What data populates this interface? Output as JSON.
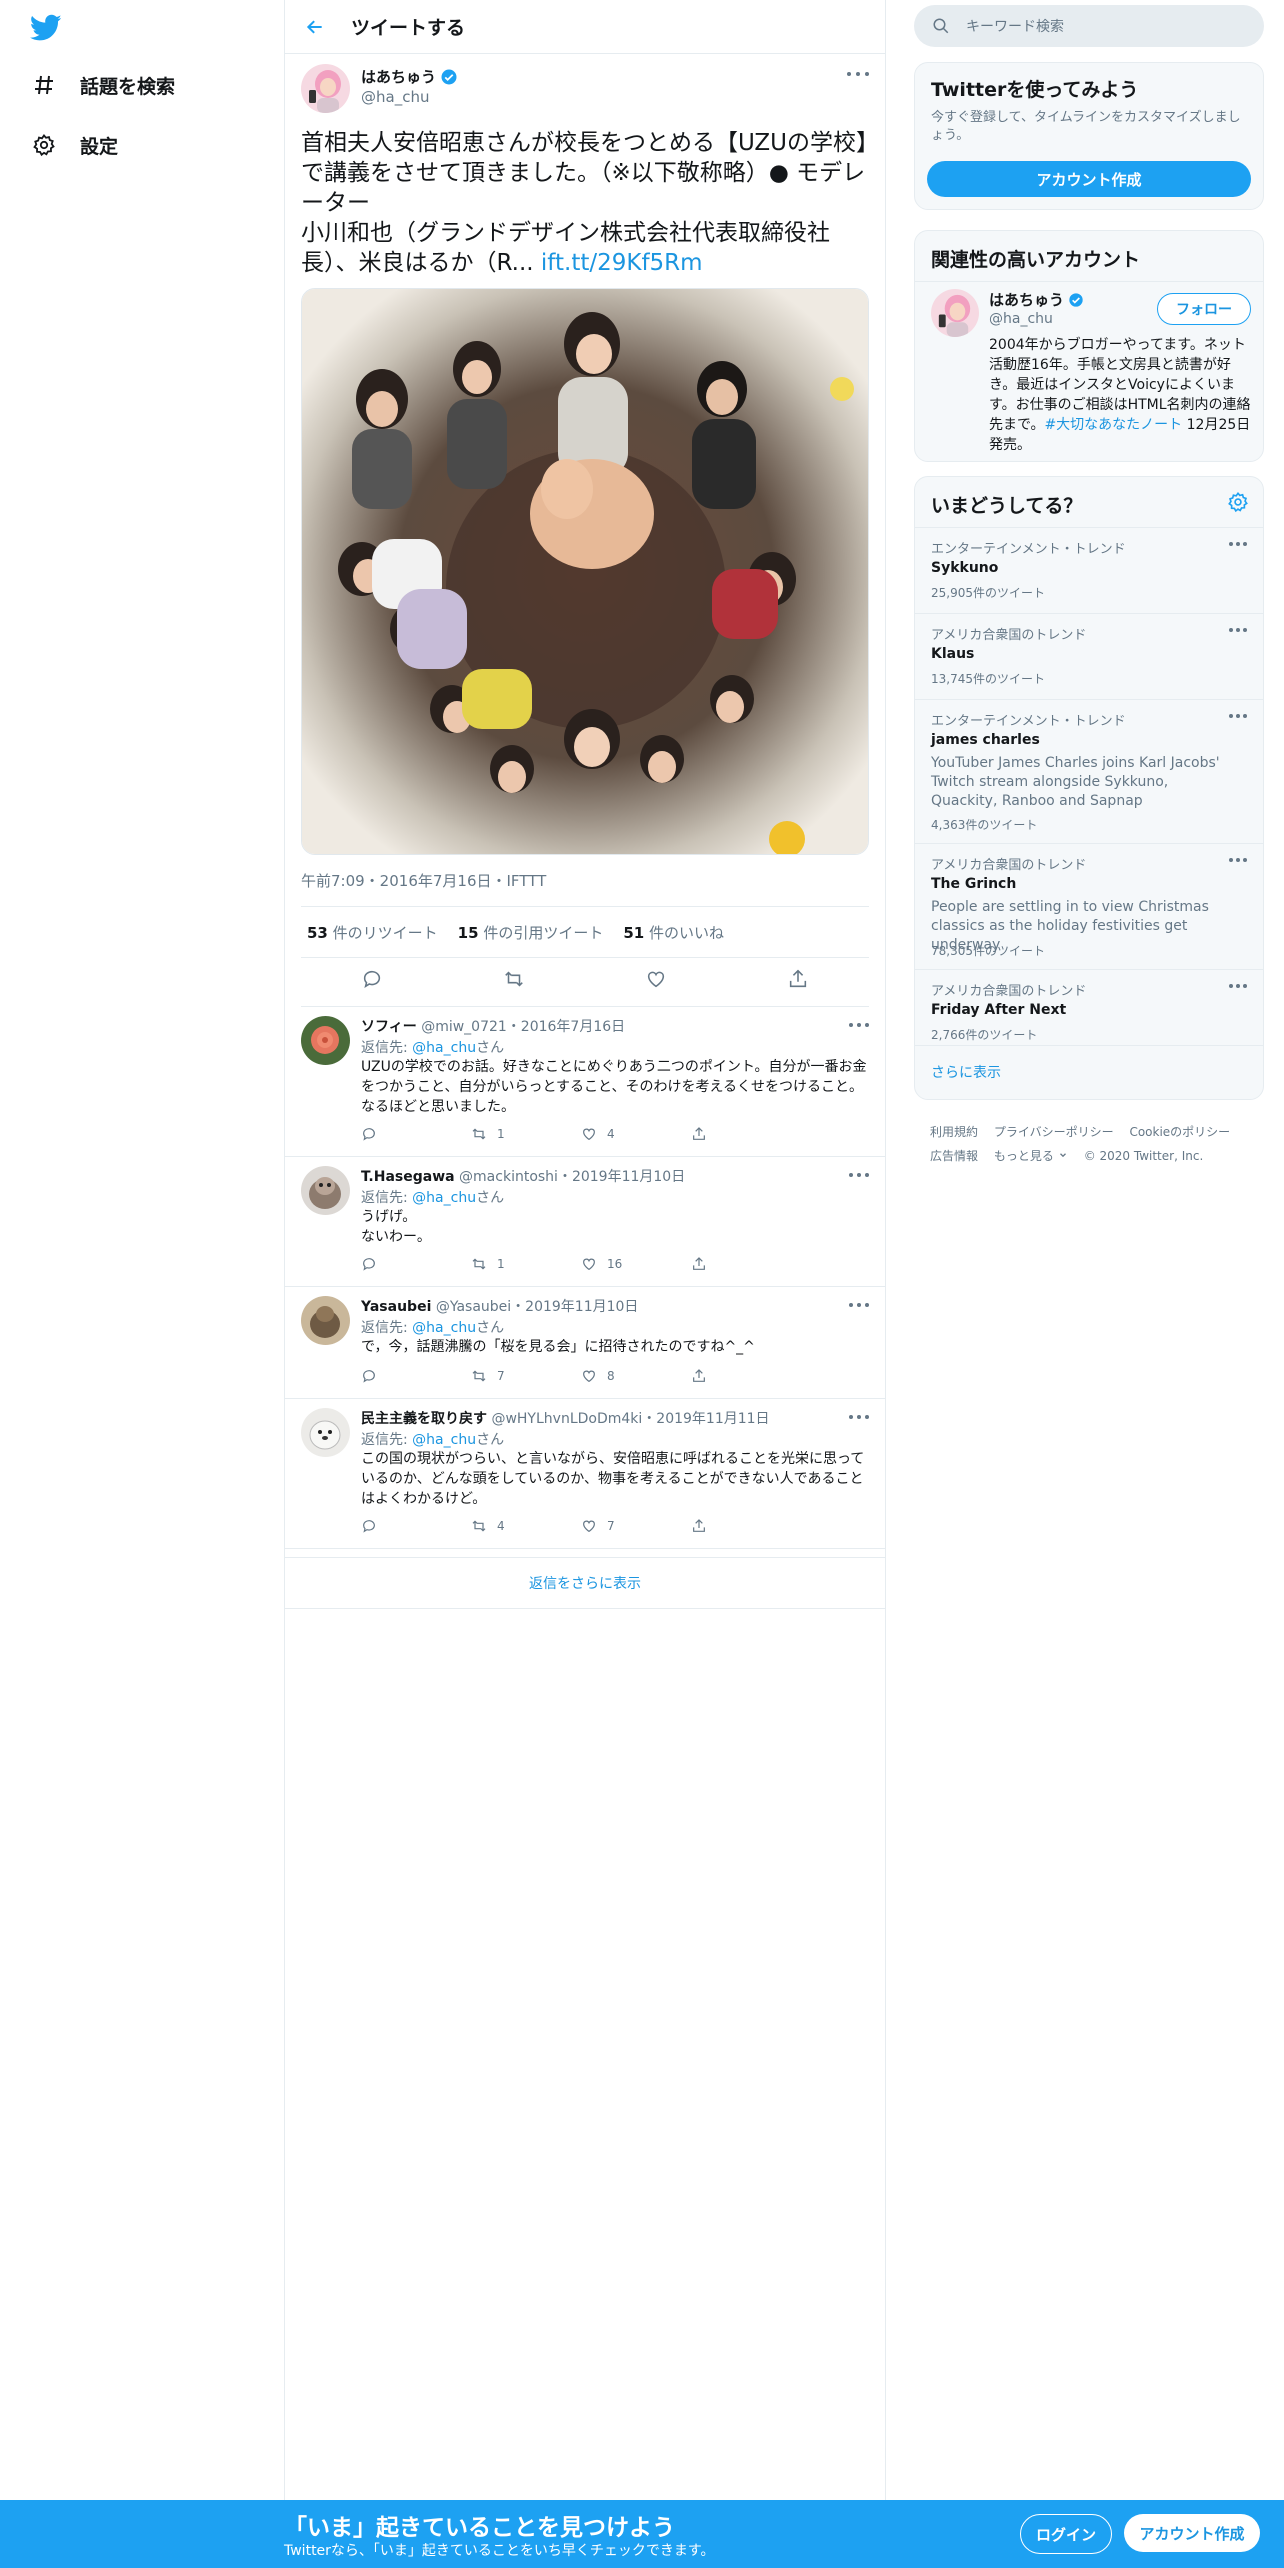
{
  "nav": {
    "explore_label": "話題を検索",
    "settings_label": "設定"
  },
  "header": {
    "title": "ツイートする"
  },
  "tweet": {
    "author_name": "はあちゅう",
    "author_handle": "@ha_chu",
    "text": "首相夫人安倍昭恵さんが校長をつとめる【UZUの学校】で講義をさせて頂きました。（※以下敬称略）● モデレーター\n小川和也（グランドデザイン株式会社代表取締役社長）、米良はるか（R... ",
    "link": "ift.tt/29Kf5Rm",
    "timestamp": "午前7:09・2016年7月16日・IFTTT",
    "retweets": "53",
    "retweets_label": "件のリツイート",
    "quotes": "15",
    "quotes_label": "件の引用ツイート",
    "likes": "51",
    "likes_label": "件のいいね"
  },
  "replies": [
    {
      "name": "ソフィー",
      "handle": "@miw_0721",
      "date": "・2016年7月16日",
      "to_prefix": "返信先: ",
      "to_handle": "@ha_chu",
      "to_suffix": "さん",
      "text": "UZUの学校でのお話。好きなことにめぐりあう二つのポイント。自分が一番お金をつかうこと、自分がいらっとすること、そのわけを考えるくせをつけること。なるほどと思いました。",
      "retweets": "1",
      "likes": "4"
    },
    {
      "name": "T.Hasegawa",
      "handle": "@mackintoshi",
      "date": "・2019年11月10日",
      "to_prefix": "返信先: ",
      "to_handle": "@ha_chu",
      "to_suffix": "さん",
      "text": "うげげ。\nないわー。",
      "retweets": "1",
      "likes": "16"
    },
    {
      "name": "Yasaubei",
      "handle": "@Yasaubei",
      "date": "・2019年11月10日",
      "to_prefix": "返信先: ",
      "to_handle": "@ha_chu",
      "to_suffix": "さん",
      "text": "で，今，話題沸騰の「桜を見る会」に招待されたのですね^_^",
      "retweets": "7",
      "likes": "8"
    },
    {
      "name": "民主主義を取り戻す",
      "handle": "@wHYLhvnLDoDm4ki",
      "date": "・2019年11月11日",
      "to_prefix": "返信先: ",
      "to_handle": "@ha_chu",
      "to_suffix": "さん",
      "text": "この国の現状がつらい、と言いながら、安倍昭恵に呼ばれることを光栄に思っているのか、どんな頭をしているのか、物事を考えることができない人であることはよくわかるけど。",
      "retweets": "4",
      "likes": "7"
    }
  ],
  "more_replies_label": "返信をさらに表示",
  "search": {
    "placeholder": "キーワード検索"
  },
  "signup_box": {
    "title": "Twitterを使ってみよう",
    "subtitle": "今すぐ登録して、タイムラインをカスタマイズしましょう。",
    "button": "アカウント作成"
  },
  "related": {
    "title": "関連性の高いアカウント",
    "name": "はあちゅう",
    "handle": "@ha_chu",
    "follow": "フォロー",
    "bio": "2004年からブロガーやってます。ネット活動歴16年。手帳と文房具と読書が好き。最近はインスタとVoicyによくいます。お仕事のご相談はHTML名刺内の連絡先まで。",
    "bio_tag": "#大切なあなたノート",
    "bio_tail": " 12月25日発売。"
  },
  "trends": {
    "title": "いまどうしてる？",
    "items": [
      {
        "category": "エンターテインメント・トレンド",
        "name": "Sykkuno",
        "desc": "",
        "count": "25,905件のツイート"
      },
      {
        "category": "アメリカ合衆国のトレンド",
        "name": "Klaus",
        "desc": "",
        "count": "13,745件のツイート"
      },
      {
        "category": "エンターテインメント・トレンド",
        "name": "james charles",
        "desc": "YouTuber James Charles joins Karl Jacobs' Twitch stream alongside Sykkuno, Quackity, Ranboo and Sapnap",
        "count": "4,363件のツイート"
      },
      {
        "category": "アメリカ合衆国のトレンド",
        "name": "The Grinch",
        "desc": "People are settling in to view Christmas classics as the holiday festivities get underway",
        "count": "78,305件のツイート"
      },
      {
        "category": "アメリカ合衆国のトレンド",
        "name": "Friday After Next",
        "desc": "",
        "count": "2,766件のツイート"
      }
    ],
    "show_more": "さらに表示"
  },
  "footer": {
    "terms": "利用規約",
    "privacy": "プライバシーポリシー",
    "cookie": "Cookieのポリシー",
    "ads": "広告情報",
    "more": "もっと見る",
    "copyright": "© 2020 Twitter, Inc."
  },
  "bottom_bar": {
    "title": "「いま」起きていることを見つけよう",
    "subtitle": "Twitterなら、「いま」起きていることをいち早くチェックできます。",
    "login": "ログイン",
    "signup": "アカウント作成"
  }
}
